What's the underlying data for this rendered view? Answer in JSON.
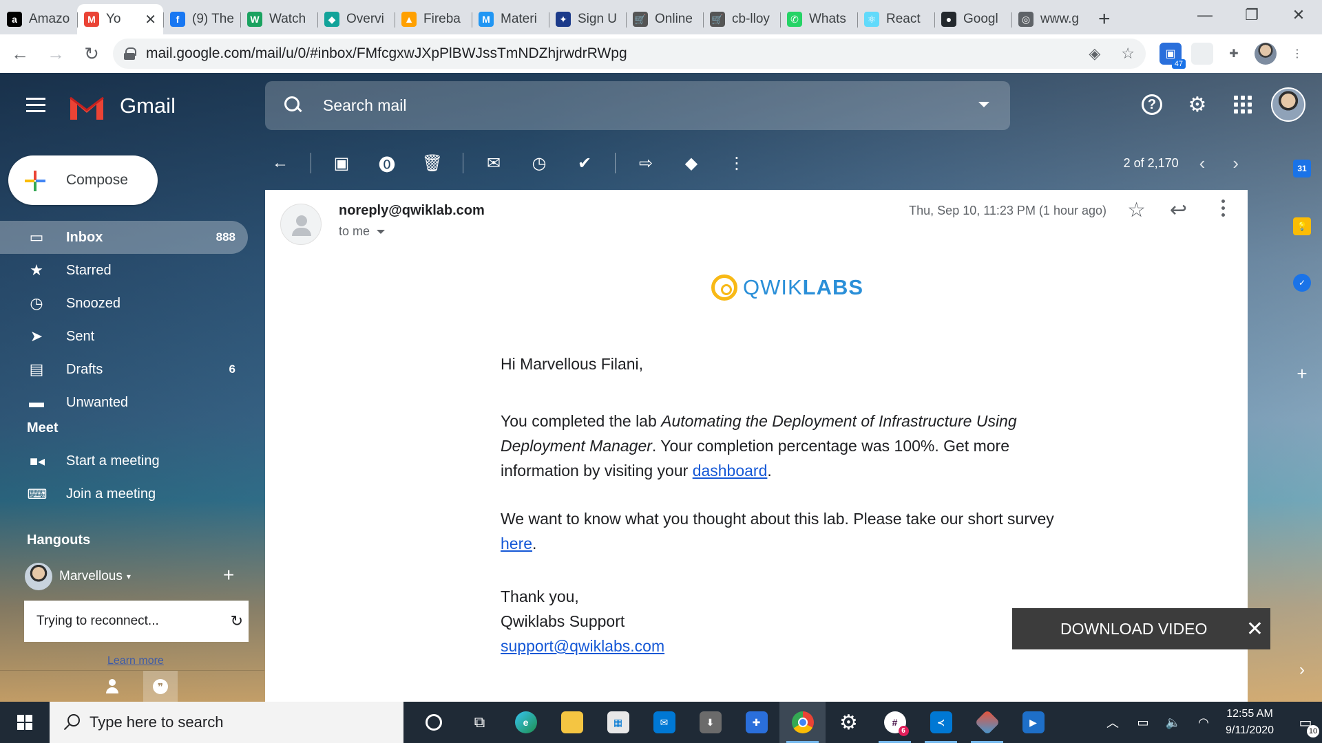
{
  "browser": {
    "tabs": [
      {
        "label": "Amazo",
        "icon": "amazon-icon",
        "color": "#000000",
        "glyph": "a"
      },
      {
        "label": "Yo",
        "icon": "gmail-icon",
        "color": "#ea4335",
        "glyph": "M",
        "active": true
      },
      {
        "label": "(9) The",
        "icon": "facebook-icon",
        "color": "#1877f2",
        "glyph": "f"
      },
      {
        "label": "Watch",
        "icon": "watch-icon",
        "color": "#1aa260",
        "glyph": "W"
      },
      {
        "label": "Overvi",
        "icon": "diamond-icon",
        "color": "#12a39a",
        "glyph": "◆"
      },
      {
        "label": "Fireba",
        "icon": "firebase-icon",
        "color": "#ffa000",
        "glyph": "▲"
      },
      {
        "label": "Materi",
        "icon": "material-icon",
        "color": "#2196f3",
        "glyph": "M"
      },
      {
        "label": "Sign U",
        "icon": "signup-icon",
        "color": "#1b3a8a",
        "glyph": "✦"
      },
      {
        "label": "Online",
        "icon": "cart-icon",
        "color": "#555555",
        "glyph": "🛒"
      },
      {
        "label": "cb-lloy",
        "icon": "cart-icon",
        "color": "#555555",
        "glyph": "🛒"
      },
      {
        "label": "Whats",
        "icon": "whatsapp-icon",
        "color": "#25d366",
        "glyph": "✆"
      },
      {
        "label": "React",
        "icon": "react-icon",
        "color": "#61dafb",
        "glyph": "⚛"
      },
      {
        "label": "Googl",
        "icon": "github-icon",
        "color": "#24292e",
        "glyph": "●"
      },
      {
        "label": "www.g",
        "icon": "globe-icon",
        "color": "#5f6368",
        "glyph": "◎"
      }
    ],
    "new_tab": "+",
    "window_controls": {
      "minimize": "—",
      "restore": "❐",
      "close": "✕"
    },
    "url": "mail.google.com/mail/u/0/#inbox/FMfcgxwJXpPlBWJssTmNDZhjrwdrRWpg",
    "extension_badge": "47"
  },
  "gmail": {
    "brand": "Gmail",
    "search_placeholder": "Search mail",
    "compose_label": "Compose",
    "nav": [
      {
        "label": "Inbox",
        "count": "888",
        "icon": "inbox-icon",
        "glyph": "▭",
        "active": true
      },
      {
        "label": "Starred",
        "count": "",
        "icon": "star-icon",
        "glyph": "★"
      },
      {
        "label": "Snoozed",
        "count": "",
        "icon": "clock-icon",
        "glyph": "◷"
      },
      {
        "label": "Sent",
        "count": "",
        "icon": "send-icon",
        "glyph": "➤"
      },
      {
        "label": "Drafts",
        "count": "6",
        "icon": "draft-icon",
        "glyph": "▤"
      },
      {
        "label": "Unwanted",
        "count": "",
        "icon": "label-icon",
        "glyph": "▬"
      }
    ],
    "meet": {
      "title": "Meet",
      "start": "Start a meeting",
      "join": "Join a meeting"
    },
    "hangouts": {
      "title": "Hangouts",
      "user": "Marvellous",
      "reconnect": "Trying to reconnect...",
      "learn_more": "Learn more"
    },
    "pager": "2 of 2,170"
  },
  "message": {
    "sender": "noreply@qwiklab.com",
    "to": "to me",
    "datetime": "Thu, Sep 10, 11:23 PM (1 hour ago)",
    "logo_light": "QWIK",
    "logo_bold": "LABS",
    "greeting": "Hi Marvellous Filani,",
    "p1_start": "You completed the lab ",
    "p1_lab": "Automating the Deployment of Infrastructure Using Deployment Manager",
    "p1_mid": ". Your completion percentage was 100%. Get more information by visiting your ",
    "p1_link": "dashboard",
    "p1_end": ".",
    "p2_start": "We want to know what you thought about this lab. Please take our short survey ",
    "p2_link": "here",
    "p2_end": ".",
    "sign1": "Thank you,",
    "sign2": "Qwiklabs Support",
    "support_link": "support@qwiklabs.com"
  },
  "download_overlay": {
    "label": "DOWNLOAD VIDEO",
    "close": "✕"
  },
  "taskbar": {
    "search_placeholder": "Type here to search",
    "time": "12:55 AM",
    "date": "9/11/2020",
    "notifications": "10",
    "slack_badge": "6"
  }
}
